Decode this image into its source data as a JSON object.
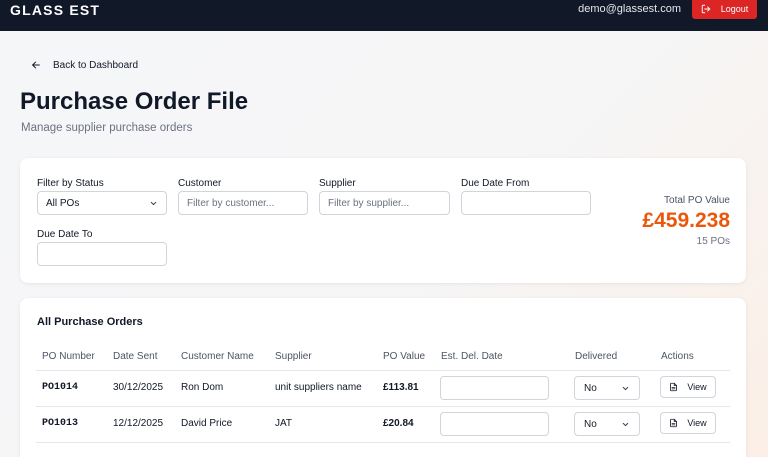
{
  "header": {
    "brand": "GLASS EST",
    "user_email": "demo@glassest.com",
    "logout_label": "Logout"
  },
  "nav": {
    "back_label": "Back to Dashboard"
  },
  "page": {
    "title": "Purchase Order File",
    "subtitle": "Manage supplier purchase orders"
  },
  "filters": {
    "status_label": "Filter by Status",
    "status_value": "All POs",
    "customer_label": "Customer",
    "customer_placeholder": "Filter by customer...",
    "supplier_label": "Supplier",
    "supplier_placeholder": "Filter by supplier...",
    "due_from_label": "Due Date From",
    "due_to_label": "Due Date To"
  },
  "summary": {
    "total_label": "Total PO Value",
    "total_value": "£459.238",
    "count_label": "15 POs"
  },
  "table": {
    "title": "All Purchase Orders",
    "columns": [
      "PO Number",
      "Date Sent",
      "Customer Name",
      "Supplier",
      "PO Value",
      "Est. Del. Date",
      "Delivered",
      "Actions"
    ],
    "rows": [
      {
        "po_number": "PO1014",
        "date_sent": "30/12/2025",
        "customer": "Ron Dom",
        "supplier": "unit suppliers name",
        "value": "£113.81",
        "delivered": "No",
        "action": "View"
      },
      {
        "po_number": "PO1013",
        "date_sent": "12/12/2025",
        "customer": "David Price",
        "supplier": "JAT",
        "value": "£20.84",
        "delivered": "No",
        "action": "View"
      }
    ]
  },
  "colors": {
    "accent": "#ea580c",
    "logout": "#dc2626",
    "header_bg": "#111827"
  }
}
